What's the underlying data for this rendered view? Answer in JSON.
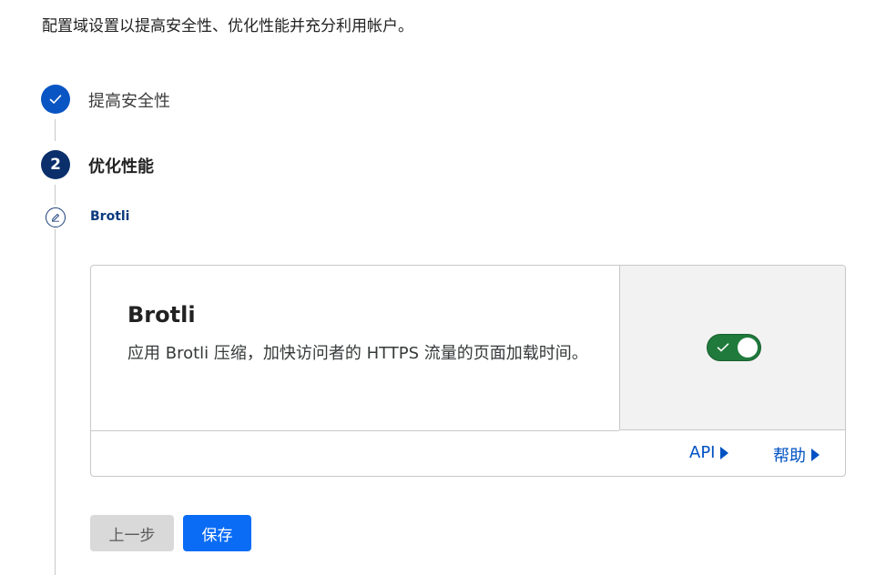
{
  "intro_text": "配置域设置以提高安全性、优化性能并充分利用帐户。",
  "steps": [
    {
      "label": "提高安全性",
      "status": "done",
      "icon": "check-icon"
    },
    {
      "label": "优化性能",
      "status": "current",
      "number": "2"
    }
  ],
  "substep": {
    "label": "Brotli",
    "icon": "pencil-icon"
  },
  "card": {
    "title": "Brotli",
    "description": "应用 Brotli 压缩，加快访问者的 HTTPS 流量的页面加载时间。",
    "toggle_on": true,
    "toggle_color": "#1f7a3c",
    "links": [
      {
        "label": "API"
      },
      {
        "label": "帮助"
      }
    ]
  },
  "buttons": {
    "prev_label": "上一步",
    "save_label": "保存"
  },
  "colors": {
    "accent": "#0a55c4",
    "current_step": "#0a2f6b",
    "link": "#0051c3",
    "primary_button": "#0a6cf5"
  }
}
